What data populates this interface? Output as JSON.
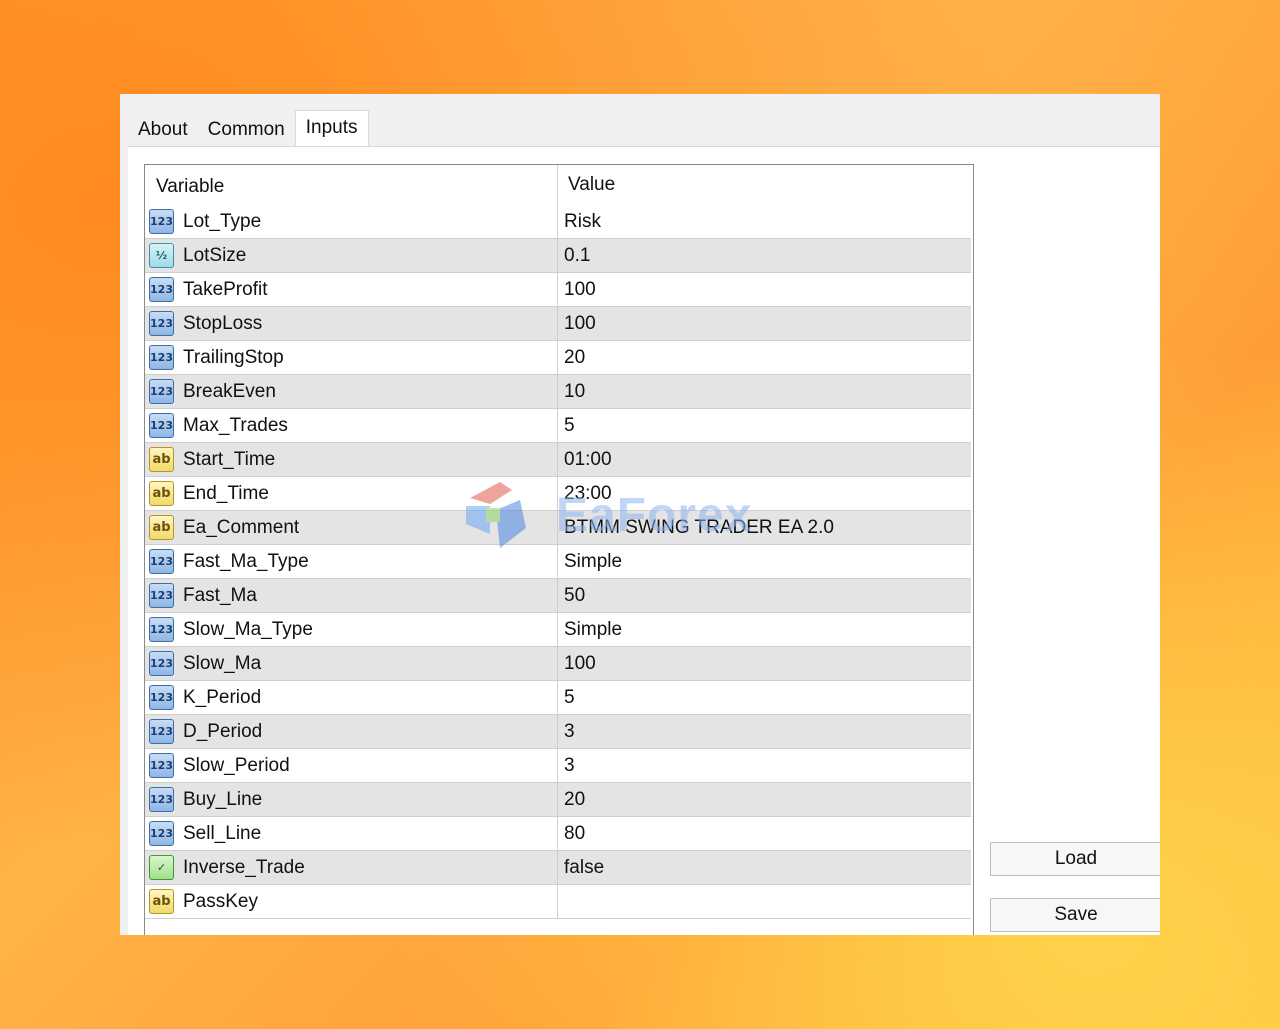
{
  "tabs": [
    {
      "label": "About"
    },
    {
      "label": "Common"
    },
    {
      "label": "Inputs"
    }
  ],
  "columns": {
    "variable": "Variable",
    "value": "Value"
  },
  "rows": [
    {
      "name": "Lot_Type",
      "value": "Risk",
      "icon": "integer-type-icon"
    },
    {
      "name": "LotSize",
      "value": "0.1",
      "icon": "double-type-icon"
    },
    {
      "name": "TakeProfit",
      "value": "100",
      "icon": "integer-type-icon"
    },
    {
      "name": "StopLoss",
      "value": "100",
      "icon": "integer-type-icon"
    },
    {
      "name": "TrailingStop",
      "value": "20",
      "icon": "integer-type-icon"
    },
    {
      "name": "BreakEven",
      "value": "10",
      "icon": "integer-type-icon"
    },
    {
      "name": "Max_Trades",
      "value": "5",
      "icon": "integer-type-icon"
    },
    {
      "name": "Start_Time",
      "value": "01:00",
      "icon": "string-type-icon"
    },
    {
      "name": "End_Time",
      "value": "23:00",
      "icon": "string-type-icon"
    },
    {
      "name": "Ea_Comment",
      "value": "BTMM SWING TRADER EA 2.0",
      "icon": "string-type-icon"
    },
    {
      "name": "Fast_Ma_Type",
      "value": "Simple",
      "icon": "integer-type-icon"
    },
    {
      "name": "Fast_Ma",
      "value": "50",
      "icon": "integer-type-icon"
    },
    {
      "name": "Slow_Ma_Type",
      "value": "Simple",
      "icon": "integer-type-icon"
    },
    {
      "name": "Slow_Ma",
      "value": "100",
      "icon": "integer-type-icon"
    },
    {
      "name": "K_Period",
      "value": "5",
      "icon": "integer-type-icon"
    },
    {
      "name": "D_Period",
      "value": "3",
      "icon": "integer-type-icon"
    },
    {
      "name": "Slow_Period",
      "value": "3",
      "icon": "integer-type-icon"
    },
    {
      "name": "Buy_Line",
      "value": "20",
      "icon": "integer-type-icon"
    },
    {
      "name": "Sell_Line",
      "value": "80",
      "icon": "integer-type-icon"
    },
    {
      "name": "Inverse_Trade",
      "value": "false",
      "icon": "boolean-type-icon"
    },
    {
      "name": "PassKey",
      "value": "",
      "icon": "string-type-icon"
    }
  ],
  "icon_glyphs": {
    "int": "123",
    "dbl": "½",
    "str": "ab",
    "bool": "✓"
  },
  "buttons": {
    "load": "Load",
    "save": "Save"
  },
  "watermark": {
    "text": "EaForex"
  }
}
